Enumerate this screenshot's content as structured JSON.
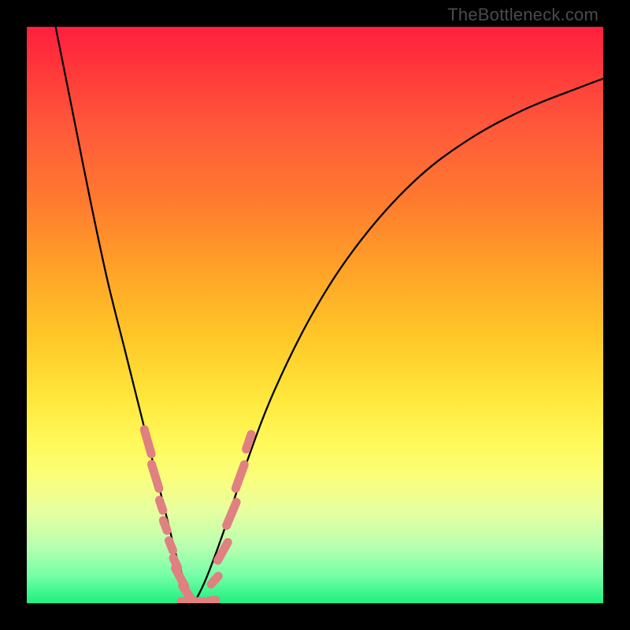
{
  "watermark": "TheBottleneck.com",
  "colors": {
    "frame": "#000000",
    "gradient_top": "#ff1f3f",
    "gradient_bottom": "#1ef07f",
    "curve": "#000000",
    "tick": "#e08080"
  },
  "chart_data": {
    "type": "line",
    "title": "",
    "xlabel": "",
    "ylabel": "",
    "xlim": [
      0,
      100
    ],
    "ylim": [
      0,
      100
    ],
    "series": [
      {
        "name": "left-curve",
        "x": [
          5,
          8,
          11,
          14,
          17,
          19,
          21,
          23,
          24.5,
          26,
          27.5,
          29
        ],
        "y": [
          100,
          85,
          70,
          56,
          44,
          36,
          28,
          20,
          14,
          8,
          3.5,
          0
        ]
      },
      {
        "name": "right-curve",
        "x": [
          29,
          31,
          34,
          38,
          43,
          50,
          58,
          67,
          76,
          86,
          96,
          100
        ],
        "y": [
          0,
          4,
          12,
          24,
          37,
          51,
          63,
          73,
          80,
          85.5,
          89.5,
          91
        ]
      }
    ],
    "markers": {
      "name": "highlight-ticks",
      "note": "salmon rounded segments along lower part of both curves",
      "points": [
        {
          "x": 21.0,
          "y": 28.0,
          "len": 6
        },
        {
          "x": 22.3,
          "y": 22.0,
          "len": 6
        },
        {
          "x": 23.3,
          "y": 17.0,
          "len": 3
        },
        {
          "x": 24.0,
          "y": 13.5,
          "len": 3
        },
        {
          "x": 25.0,
          "y": 10.0,
          "len": 3
        },
        {
          "x": 25.8,
          "y": 7.0,
          "len": 3
        },
        {
          "x": 26.6,
          "y": 4.5,
          "len": 5
        },
        {
          "x": 28.0,
          "y": 1.5,
          "len": 5
        },
        {
          "x": 29.0,
          "y": 0.3,
          "len": 6
        },
        {
          "x": 31.0,
          "y": 0.3,
          "len": 5
        },
        {
          "x": 32.6,
          "y": 4.0,
          "len": 3
        },
        {
          "x": 34.0,
          "y": 9.0,
          "len": 5
        },
        {
          "x": 35.5,
          "y": 15.5,
          "len": 6
        },
        {
          "x": 37.0,
          "y": 22.0,
          "len": 6
        },
        {
          "x": 38.5,
          "y": 28.0,
          "len": 4
        }
      ]
    }
  }
}
